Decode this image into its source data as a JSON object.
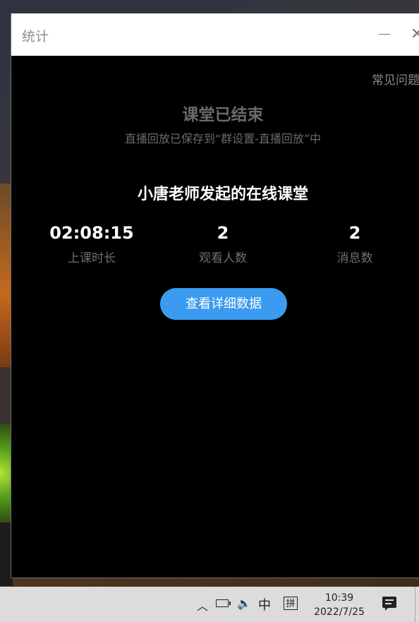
{
  "window": {
    "title": "统计",
    "minimize_glyph": "—",
    "close_glyph": "✕"
  },
  "content": {
    "faq_link": "常见问题",
    "ended_title": "课堂已结束",
    "ended_subtitle": "直播回放已保存到“群设置-直播回放”中",
    "class_title": "小唐老师发起的在线课堂",
    "stats": [
      {
        "value": "02:08:15",
        "label": "上课时长"
      },
      {
        "value": "2",
        "label": "观看人数"
      },
      {
        "value": "2",
        "label": "消息数"
      }
    ],
    "detail_button": "查看详细数据",
    "accent_color": "#3a9bf0"
  },
  "taskbar": {
    "ime_mode": "中",
    "ime_type": "拼",
    "time": "10:39",
    "date": "2022/7/25",
    "icons": [
      "chevron-up-icon",
      "battery-icon",
      "volume-icon",
      "notification-icon"
    ]
  }
}
